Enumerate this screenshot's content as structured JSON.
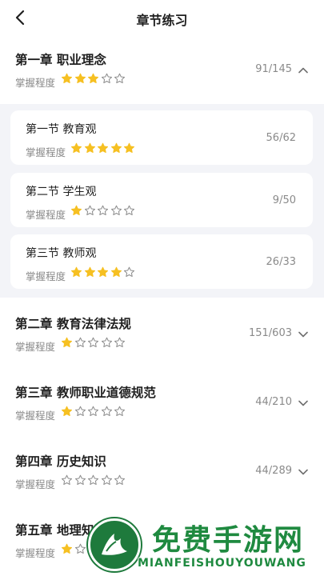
{
  "header": {
    "title": "章节练习"
  },
  "mastery_label": "掌握程度",
  "chapters": [
    {
      "name": "第一章 职业理念",
      "count": "91/145",
      "stars": 3,
      "expanded": true,
      "sections": [
        {
          "name": "第一节 教育观",
          "count": "56/62",
          "stars": 5
        },
        {
          "name": "第二节 学生观",
          "count": "9/50",
          "stars": 1
        },
        {
          "name": "第三节 教师观",
          "count": "26/33",
          "stars": 4
        }
      ]
    },
    {
      "name": "第二章 教育法律法规",
      "count": "151/603",
      "stars": 1,
      "expanded": false
    },
    {
      "name": "第三章 教师职业道德规范",
      "count": "44/210",
      "stars": 1,
      "expanded": false
    },
    {
      "name": "第四章 历史知识",
      "count": "44/289",
      "stars": 0,
      "expanded": false
    },
    {
      "name": "第五章 地理知识",
      "count": "",
      "stars": 1,
      "expanded": false
    }
  ],
  "watermark": {
    "text": "免费手游网",
    "subtext": "MIANFEISHOUYOUWANG"
  },
  "colors": {
    "star_on": "#f6c022",
    "star_off": "#8e8e8e",
    "expanded_bg": "#f3f4f8",
    "watermark": "#1f8a40"
  }
}
